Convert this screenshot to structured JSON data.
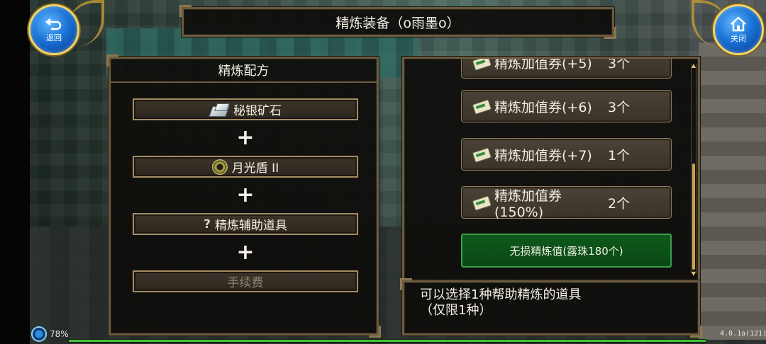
{
  "header": {
    "title": "精炼装备（o雨墨o）",
    "back_label": "返回",
    "close_label": "关闭"
  },
  "recipe": {
    "title": "精炼配方",
    "material": "秘银矿石",
    "equipment": "月光盾 II",
    "assist": "精炼辅助道具",
    "fee": "手续费",
    "plus": "+"
  },
  "tickets": [
    {
      "name": "精炼加值券(+5)",
      "count": "3个"
    },
    {
      "name": "精炼加值券(+6)",
      "count": "3个"
    },
    {
      "name": "精炼加值券(+7)",
      "count": "1个"
    },
    {
      "name": "精炼加值券(150%)",
      "count": "2个"
    }
  ],
  "lossless_button": "无损精炼值(露珠180个)",
  "info": {
    "line1": "可以选择1种帮助精炼的道具",
    "line2": "（仅限1种）"
  },
  "status": {
    "battery": "78%",
    "version": "4.0.1a(121)",
    "exp_fraction": 1.0
  },
  "colors": {
    "frame": "#6b5b3e",
    "accent_green": "#0d5a1a",
    "button_blue": "#1a73d6"
  }
}
